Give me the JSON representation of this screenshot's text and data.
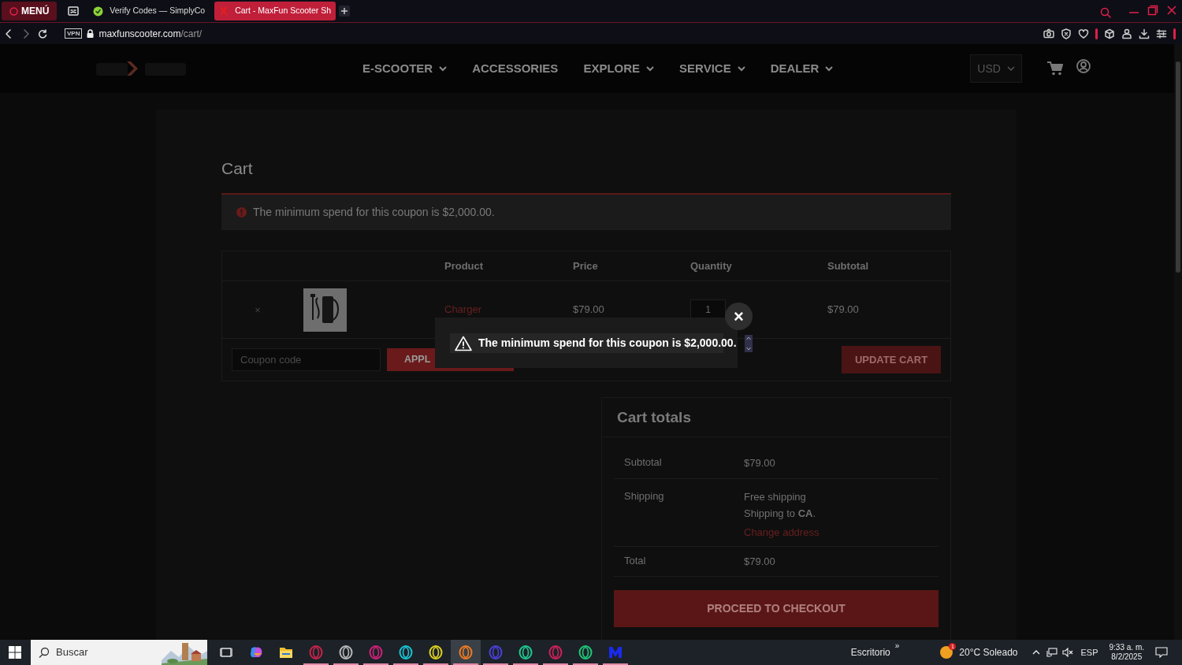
{
  "browser": {
    "menu_label": "MENÚ",
    "tabs": [
      {
        "title": "Verify Codes — SimplyCo",
        "selected": false
      },
      {
        "title": "Cart - MaxFun Scooter Sh",
        "selected": true
      }
    ],
    "url_domain": "maxfunscooter.com",
    "url_path": "/cart/",
    "vpn_label": "VPN"
  },
  "site_nav": {
    "items": [
      {
        "label": "E-SCOOTER",
        "has_menu": true
      },
      {
        "label": "ACCESSORIES",
        "has_menu": false
      },
      {
        "label": "EXPLORE",
        "has_menu": true
      },
      {
        "label": "SERVICE",
        "has_menu": true
      },
      {
        "label": "DEALER",
        "has_menu": true
      }
    ],
    "currency": "USD"
  },
  "cart": {
    "title": "Cart",
    "notice": "The minimum spend for this coupon is $2,000.00.",
    "columns": [
      "Product",
      "Price",
      "Quantity",
      "Subtotal"
    ],
    "items": [
      {
        "remove": "×",
        "product": "Charger",
        "price": "$79.00",
        "quantity": "1",
        "subtotal": "$79.00"
      }
    ],
    "coupon_placeholder": "Coupon code",
    "apply_label": "APPL",
    "update_label": "UPDATE CART"
  },
  "totals": {
    "title": "Cart totals",
    "rows": [
      {
        "label": "Subtotal",
        "lines": [
          "$79.00"
        ]
      },
      {
        "label": "Shipping",
        "lines": [
          "Free shipping",
          "Shipping to **CA**."
        ],
        "link": "Change address"
      },
      {
        "label": "Total",
        "lines": [
          "$79.00"
        ]
      }
    ],
    "checkout_label": "PROCEED TO CHECKOUT"
  },
  "modal": {
    "message": "The minimum spend for this coupon is $2,000.00.",
    "close": "×"
  },
  "taskbar": {
    "search_placeholder": "Buscar",
    "apps": [
      {
        "kind": "taskview",
        "selected": false
      },
      {
        "kind": "copilot",
        "selected": false
      },
      {
        "kind": "folder",
        "selected": false
      },
      {
        "kind": "opera",
        "color": "#c8234a",
        "selected": false
      },
      {
        "kind": "opera",
        "color": "#b8b8b8",
        "selected": false
      },
      {
        "kind": "opera",
        "color": "#d0207a",
        "selected": false
      },
      {
        "kind": "opera",
        "color": "#19c4d4",
        "selected": false
      },
      {
        "kind": "opera",
        "color": "#e0d020",
        "selected": false
      },
      {
        "kind": "opera",
        "color": "#f07a20",
        "selected": true
      },
      {
        "kind": "opera",
        "color": "#4a40d8",
        "selected": false
      },
      {
        "kind": "opera",
        "color": "#20c890",
        "selected": false
      },
      {
        "kind": "opera",
        "color": "#d0205a",
        "selected": false
      },
      {
        "kind": "opera",
        "color": "#20c878",
        "selected": false
      },
      {
        "kind": "m",
        "selected": false
      }
    ],
    "desktop_label": "Escritorio",
    "desktop_more": "»",
    "weather_badge": "1",
    "weather": "20°C  Soleado",
    "language": "ESP",
    "time": "9:33 a. m.",
    "date": "8/2/2025"
  }
}
